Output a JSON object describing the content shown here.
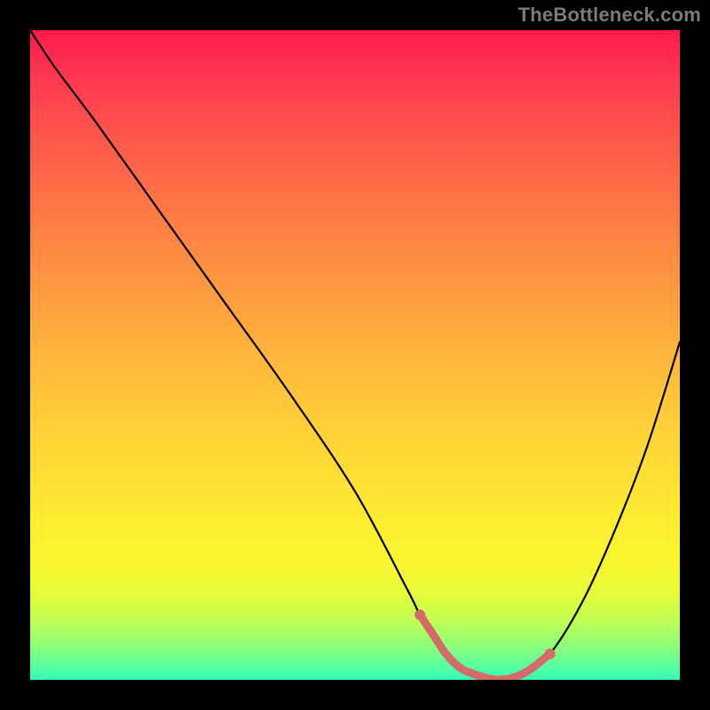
{
  "watermark": "TheBottleneck.com",
  "colors": {
    "background_frame": "#000000",
    "curve": "#000000",
    "highlight": "#d46a6a",
    "gradient_top": "#ff1a4d",
    "gradient_bottom": "#35ffb8"
  },
  "chart_data": {
    "type": "line",
    "title": "",
    "xlabel": "",
    "ylabel": "",
    "xlim": [
      0,
      100
    ],
    "ylim": [
      0,
      100
    ],
    "grid": false,
    "series": [
      {
        "name": "bottleneck-curve",
        "x": [
          0,
          4,
          10,
          20,
          30,
          40,
          50,
          58,
          60,
          62,
          64,
          66,
          68,
          72,
          76,
          80,
          85,
          90,
          95,
          100
        ],
        "y": [
          100,
          94,
          86,
          72,
          58,
          44,
          29,
          14,
          10,
          7,
          4,
          2,
          1,
          0,
          1,
          4,
          12,
          23,
          36,
          52
        ]
      }
    ],
    "annotations": [
      {
        "name": "optimal-range",
        "x_start": 60,
        "x_end": 80,
        "note": "thick pink segment at valley, dots at endpoints"
      }
    ]
  }
}
